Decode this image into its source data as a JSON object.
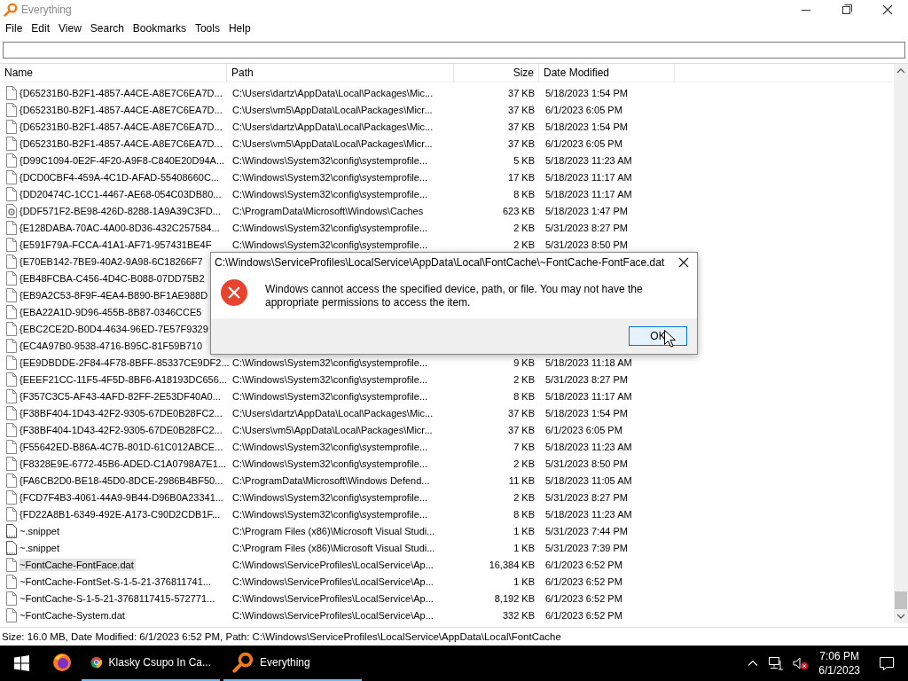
{
  "window": {
    "title": "Everything"
  },
  "menu": [
    "File",
    "Edit",
    "View",
    "Search",
    "Bookmarks",
    "Tools",
    "Help"
  ],
  "table": {
    "columns": [
      "Name",
      "Path",
      "Size",
      "Date Modified"
    ],
    "rows": [
      {
        "kind": "file",
        "name": "{D65231B0-B2F1-4857-A4CE-A8E7C6EA7D...",
        "path": "C:\\Users\\dartz\\AppData\\Local\\Packages\\Mic...",
        "size": "37 KB",
        "date": "5/18/2023 1:54 PM",
        "selected": false
      },
      {
        "kind": "file",
        "name": "{D65231B0-B2F1-4857-A4CE-A8E7C6EA7D...",
        "path": "C:\\Users\\vm5\\AppData\\Local\\Packages\\Micr...",
        "size": "37 KB",
        "date": "6/1/2023 6:05 PM",
        "selected": false
      },
      {
        "kind": "file",
        "name": "{D65231B0-B2F1-4857-A4CE-A8E7C6EA7D...",
        "path": "C:\\Users\\dartz\\AppData\\Local\\Packages\\Mic...",
        "size": "37 KB",
        "date": "5/18/2023 1:54 PM",
        "selected": false
      },
      {
        "kind": "file",
        "name": "{D65231B0-B2F1-4857-A4CE-A8E7C6EA7D...",
        "path": "C:\\Users\\vm5\\AppData\\Local\\Packages\\Micr...",
        "size": "37 KB",
        "date": "6/1/2023 6:05 PM",
        "selected": false
      },
      {
        "kind": "file",
        "name": "{D99C1094-0E2F-4F20-A9F8-C840E20D94A...",
        "path": "C:\\Windows\\System32\\config\\systemprofile...",
        "size": "5 KB",
        "date": "5/18/2023 11:23 AM",
        "selected": false
      },
      {
        "kind": "file",
        "name": "{DCD0CBF4-459A-4C1D-AFAD-55408660C...",
        "path": "C:\\Windows\\System32\\config\\systemprofile...",
        "size": "17 KB",
        "date": "5/18/2023 11:17 AM",
        "selected": false
      },
      {
        "kind": "file",
        "name": "{DD20474C-1CC1-4467-AE68-054C03DB80...",
        "path": "C:\\Windows\\System32\\config\\systemprofile...",
        "size": "8 KB",
        "date": "5/18/2023 11:17 AM",
        "selected": false
      },
      {
        "kind": "cache",
        "name": "{DDF571F2-BE98-426D-8288-1A9A39C3FD...",
        "path": "C:\\ProgramData\\Microsoft\\Windows\\Caches",
        "size": "623 KB",
        "date": "5/18/2023 1:47 PM",
        "selected": false
      },
      {
        "kind": "file",
        "name": "{E128DABA-70AC-4A00-8D36-432C257584...",
        "path": "C:\\Windows\\System32\\config\\systemprofile...",
        "size": "2 KB",
        "date": "5/31/2023 8:27 PM",
        "selected": false
      },
      {
        "kind": "file",
        "name": "{E591F79A-FCCA-41A1-AF71-957431BE4F",
        "path": "C:\\Windows\\System32\\config\\systemprofile...",
        "size": "2 KB",
        "date": "5/31/2023 8:50 PM",
        "selected": false
      },
      {
        "kind": "file",
        "name": "{E70EB142-7BE9-40A2-9A98-6C18266F7",
        "selected": false
      },
      {
        "kind": "file",
        "name": "{EB48FCBA-C456-4D4C-B088-07DD75B2",
        "selected": false
      },
      {
        "kind": "file",
        "name": "{EB9A2C53-8F9F-4EA4-B890-BF1AE988D",
        "selected": false
      },
      {
        "kind": "file",
        "name": "{EBA22A1D-9D96-455B-8B87-0346CCE5",
        "selected": false
      },
      {
        "kind": "file",
        "name": "{EBC2CE2D-B0D4-4634-96ED-7E57F9329",
        "selected": false
      },
      {
        "kind": "file",
        "name": "{EC4A97B0-9538-4716-B95C-81F59B710",
        "selected": false
      },
      {
        "kind": "file",
        "name": "{EE9DBDDE-2F84-4F78-8BFF-85337CE9DF2...",
        "path": "C:\\Windows\\System32\\config\\systemprofile...",
        "size": "9 KB",
        "date": "5/18/2023 11:18 AM",
        "selected": false
      },
      {
        "kind": "file",
        "name": "{EEEF21CC-11F5-4F5D-8BF6-A18193DC656...",
        "path": "C:\\Windows\\System32\\config\\systemprofile...",
        "size": "2 KB",
        "date": "5/31/2023 8:27 PM",
        "selected": false
      },
      {
        "kind": "file",
        "name": "{F357C3C5-AF43-4AFD-82FF-2E53DF40A0...",
        "path": "C:\\Windows\\System32\\config\\systemprofile...",
        "size": "8 KB",
        "date": "5/18/2023 11:17 AM",
        "selected": false
      },
      {
        "kind": "file",
        "name": "{F38BF404-1D43-42F2-9305-67DE0B28FC2...",
        "path": "C:\\Users\\dartz\\AppData\\Local\\Packages\\Mic...",
        "size": "37 KB",
        "date": "5/18/2023 1:54 PM",
        "selected": false
      },
      {
        "kind": "file",
        "name": "{F38BF404-1D43-42F2-9305-67DE0B28FC2...",
        "path": "C:\\Users\\vm5\\AppData\\Local\\Packages\\Micr...",
        "size": "37 KB",
        "date": "6/1/2023 6:05 PM",
        "selected": false
      },
      {
        "kind": "file",
        "name": "{F55642ED-B86A-4C7B-801D-61C012ABCE...",
        "path": "C:\\Windows\\System32\\config\\systemprofile...",
        "size": "7 KB",
        "date": "5/18/2023 11:23 AM",
        "selected": false
      },
      {
        "kind": "file",
        "name": "{F8328E9E-6772-45B6-ADED-C1A0798A7E1...",
        "path": "C:\\Windows\\System32\\config\\systemprofile...",
        "size": "2 KB",
        "date": "5/31/2023 8:50 PM",
        "selected": false
      },
      {
        "kind": "file",
        "name": "{FA6CB2D0-BE18-45D0-8DCE-2986B4BF50...",
        "path": "C:\\ProgramData\\Microsoft\\Windows Defend...",
        "size": "11 KB",
        "date": "5/18/2023 11:05 AM",
        "selected": false
      },
      {
        "kind": "file",
        "name": "{FCD7F4B3-4061-44A9-9B44-D96B0A23341...",
        "path": "C:\\Windows\\System32\\config\\systemprofile...",
        "size": "2 KB",
        "date": "5/31/2023 8:27 PM",
        "selected": false
      },
      {
        "kind": "file",
        "name": "{FD22A8B1-6349-492E-A173-C90D2CDB1F...",
        "path": "C:\\Windows\\System32\\config\\systemprofile...",
        "size": "8 KB",
        "date": "5/18/2023 11:23 AM",
        "selected": false
      },
      {
        "kind": "snippet",
        "name": "~.snippet",
        "path": "C:\\Program Files (x86)\\Microsoft Visual Studi...",
        "size": "1 KB",
        "date": "5/31/2023 7:44 PM",
        "selected": false
      },
      {
        "kind": "snippet",
        "name": "~.snippet",
        "path": "C:\\Program Files (x86)\\Microsoft Visual Studi...",
        "size": "1 KB",
        "date": "5/31/2023 7:39 PM",
        "selected": false
      },
      {
        "kind": "file",
        "name": "~FontCache-FontFace.dat",
        "path": "C:\\Windows\\ServiceProfiles\\LocalService\\Ap...",
        "size": "16,384 KB",
        "date": "6/1/2023 6:52 PM",
        "selected": true
      },
      {
        "kind": "file",
        "name": "~FontCache-FontSet-S-1-5-21-376811741...",
        "path": "C:\\Windows\\ServiceProfiles\\LocalService\\Ap...",
        "size": "1 KB",
        "date": "6/1/2023 6:52 PM",
        "selected": false
      },
      {
        "kind": "file",
        "name": "~FontCache-S-1-5-21-3768117415-572771...",
        "path": "C:\\Windows\\ServiceProfiles\\LocalService\\Ap...",
        "size": "8,192 KB",
        "date": "6/1/2023 6:52 PM",
        "selected": false
      },
      {
        "kind": "file",
        "name": "~FontCache-System.dat",
        "path": "C:\\Windows\\ServiceProfiles\\LocalService\\Ap...",
        "size": "332 KB",
        "date": "6/1/2023 6:52 PM",
        "selected": false
      }
    ]
  },
  "status_bar": "Size: 16.0 MB, Date Modified: 6/1/2023 6:52 PM, Path: C:\\Windows\\ServiceProfiles\\LocalService\\AppData\\Local\\FontCache",
  "dialog": {
    "title": "C:\\Windows\\ServiceProfiles\\LocalService\\AppData\\Local\\FontCache\\~FontCache-FontFace.dat",
    "message": "Windows cannot access the specified device, path, or file. You may not have the appropriate permissions to access the item.",
    "buttons": [
      "OK"
    ]
  },
  "taskbar": {
    "apps": [
      {
        "kind": "firefox",
        "running": false
      },
      {
        "kind": "chrome",
        "label": "Klasky Csupo In Ca...",
        "running": true
      },
      {
        "kind": "everything",
        "label": "Everything",
        "running": true
      }
    ],
    "clock": {
      "time": "7:06 PM",
      "date": "6/1/2023"
    }
  }
}
